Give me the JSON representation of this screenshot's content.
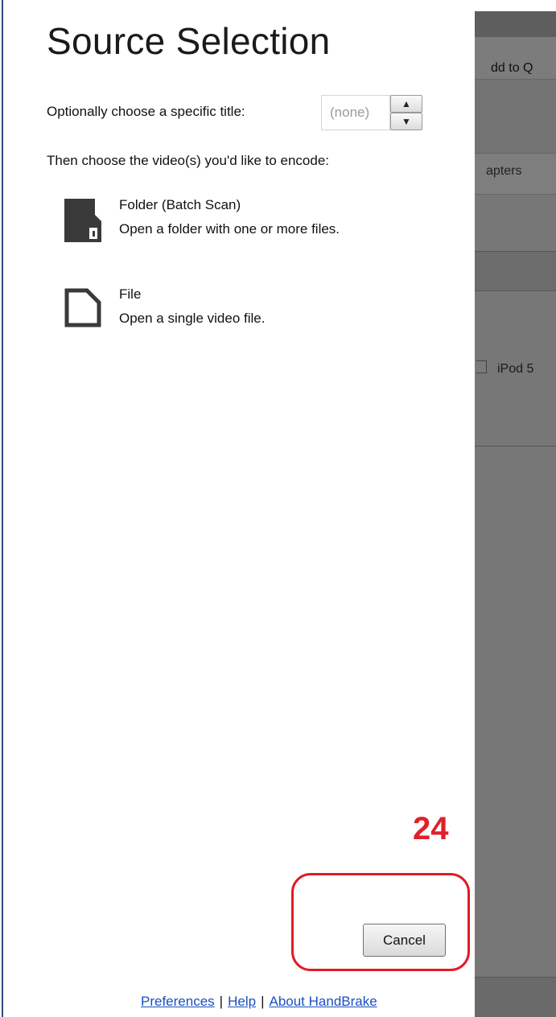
{
  "dialog": {
    "title": "Source Selection",
    "title_picker_label": "Optionally choose a specific title:",
    "title_picker_value": "(none)",
    "choose_prompt": "Then choose the video(s) you'd like to encode:",
    "options": [
      {
        "icon": "folder-icon",
        "label": "Folder (Batch Scan)",
        "description": "Open a folder with one or more files."
      },
      {
        "icon": "file-icon",
        "label": "File",
        "description": "Open a single video file."
      }
    ],
    "cancel_label": "Cancel",
    "footer_links": [
      "Preferences",
      "Help",
      "About HandBrake"
    ],
    "footer_separator": "|"
  },
  "annotation": {
    "number": "24",
    "color": "#e21b23"
  },
  "background_app": {
    "toolbar_text": "dd to Q",
    "tab_text": "apters",
    "checkbox_text": "iPod 5"
  }
}
